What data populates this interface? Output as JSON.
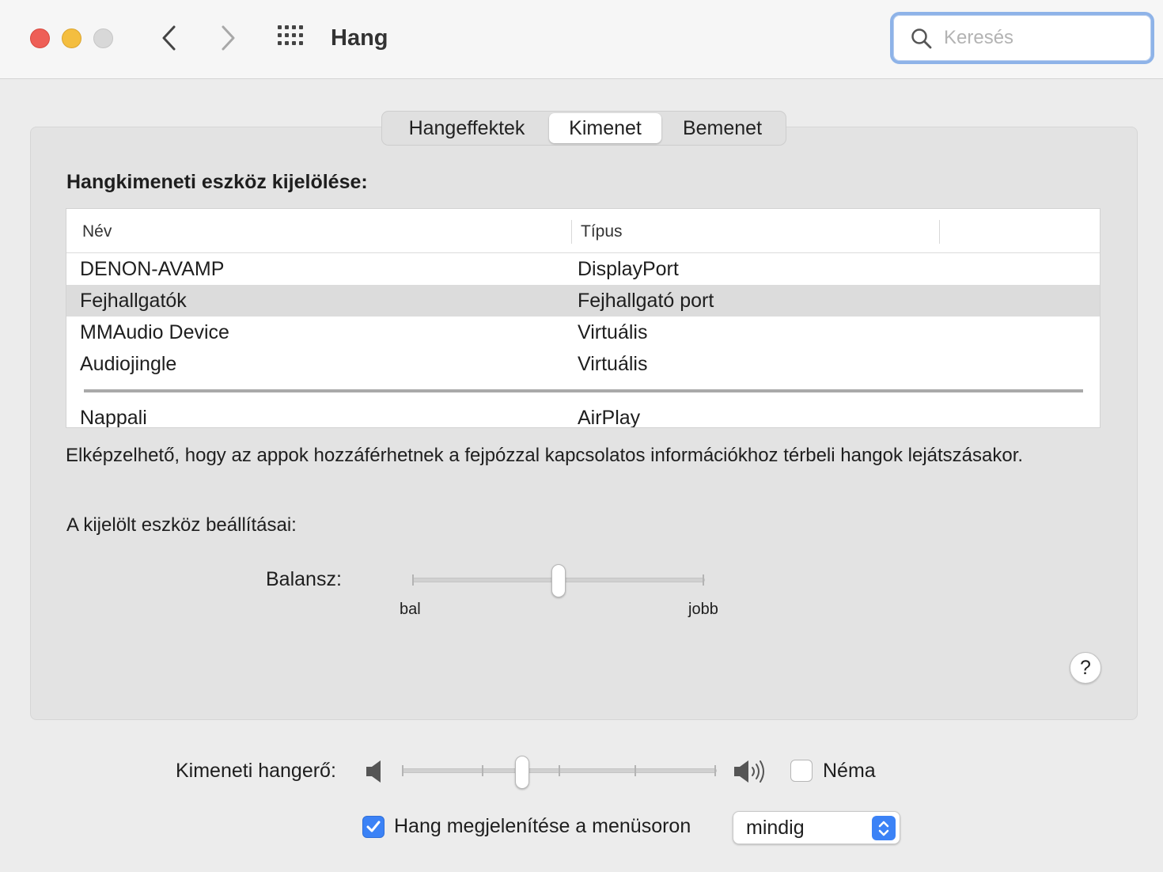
{
  "window": {
    "title": "Hang",
    "search_placeholder": "Keresés"
  },
  "tabs": [
    {
      "label": "Hangeffektek",
      "selected": false
    },
    {
      "label": "Kimenet",
      "selected": true
    },
    {
      "label": "Bemenet",
      "selected": false
    }
  ],
  "output": {
    "section_title": "Hangkimeneti eszköz kijelölése:",
    "columns": {
      "name": "Név",
      "type": "Típus"
    },
    "devices": [
      {
        "name": "DENON-AVAMP",
        "type": "DisplayPort",
        "selected": false
      },
      {
        "name": "Fejhallgatók",
        "type": "Fejhallgató port",
        "selected": true
      },
      {
        "name": "MMAudio Device",
        "type": "Virtuális",
        "selected": false
      },
      {
        "name": "Audiojingle",
        "type": "Virtuális",
        "selected": false
      },
      {
        "name": "Nappali",
        "type": "AirPlay",
        "selected": false
      }
    ],
    "info_text": "Elképzelhető, hogy az appok hozzáférhetnek a fejpózzal kapcsolatos információkhoz térbeli hangok lejátszásakor.",
    "settings_label": "A kijelölt eszköz beállításai:",
    "balance": {
      "label": "Balansz:",
      "min_label": "bal",
      "max_label": "jobb",
      "value": 0.5
    },
    "help": "?"
  },
  "volume": {
    "label": "Kimeneti hangerő:",
    "value": 0.38,
    "mute_label": "Néma",
    "muted": false
  },
  "menubar": {
    "label": "Hang megjelenítése a menüsoron",
    "checked": true,
    "selected_option": "mindig"
  },
  "colors": {
    "accent": "#3b82f6",
    "close": "#ee5f57",
    "minimize": "#f4be3f",
    "zoom_disabled": "#d8d8d8"
  },
  "icons": [
    "chevron-left-icon",
    "chevron-right-icon",
    "grid-icon",
    "search-icon",
    "speaker-low-icon",
    "speaker-high-icon",
    "checkmark-icon",
    "updown-arrows-icon"
  ]
}
